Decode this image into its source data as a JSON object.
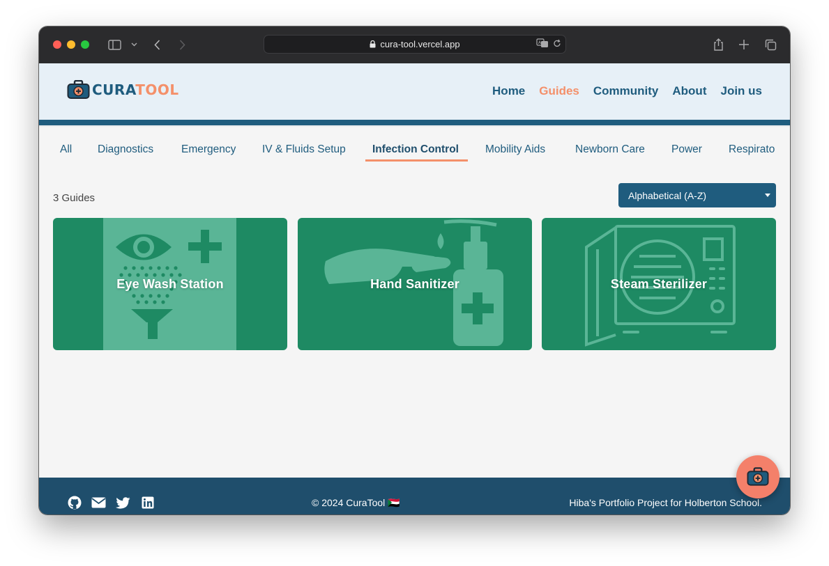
{
  "browser": {
    "url": "cura-tool.vercel.app"
  },
  "brand": {
    "logo_cura": "CURA",
    "logo_tool": "TOOL",
    "colors": {
      "primary": "#1f5c7e",
      "accent": "#f4906a",
      "card": "#1e8a63"
    }
  },
  "nav": {
    "items": [
      {
        "label": "Home"
      },
      {
        "label": "Guides"
      },
      {
        "label": "Community"
      },
      {
        "label": "About"
      },
      {
        "label": "Join us"
      }
    ],
    "active": "Guides"
  },
  "categories": {
    "items": [
      {
        "label": "All"
      },
      {
        "label": "Diagnostics"
      },
      {
        "label": "Emergency"
      },
      {
        "label": "IV & Fluids Setup"
      },
      {
        "label": "Infection Control"
      },
      {
        "label": "Mobility Aids"
      },
      {
        "label": "Newborn Care"
      },
      {
        "label": "Power"
      },
      {
        "label": "Respirato"
      }
    ],
    "active": "Infection Control"
  },
  "listing": {
    "count_label": "3 Guides",
    "sort_selected": "Alphabetical (A-Z)"
  },
  "guides": [
    {
      "title": "Eye Wash Station",
      "icon": "eye-wash-icon"
    },
    {
      "title": "Hand Sanitizer",
      "icon": "hand-sanitizer-icon"
    },
    {
      "title": "Steam Sterilizer",
      "icon": "steam-sterilizer-icon"
    }
  ],
  "footer": {
    "social": [
      "github-icon",
      "mail-icon",
      "twitter-icon",
      "linkedin-icon"
    ],
    "copyright": "© 2024 CuraTool 🇸🇩",
    "credit": "Hiba's Portfolio Project for Holberton School."
  }
}
